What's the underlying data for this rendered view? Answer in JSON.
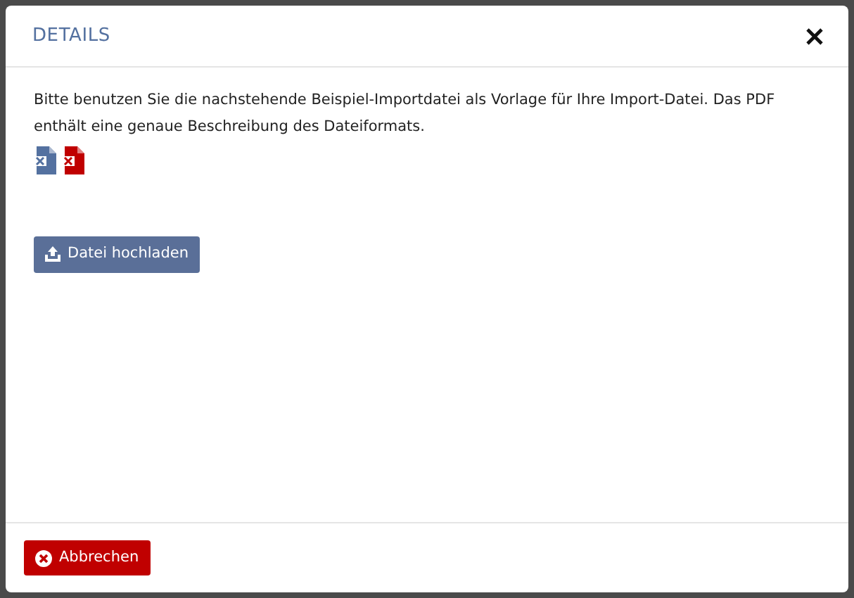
{
  "dialog": {
    "title": "DETAILS",
    "description": "Bitte benutzen Sie die nachstehende Beispiel-Importdatei als Vorlage für Ihre Import-Datei. Das PDF enthält eine genaue Beschreibung des Dateiformats.",
    "files": [
      {
        "kind": "csv"
      },
      {
        "kind": "pdf"
      }
    ],
    "upload_button": "Datei hochladen",
    "cancel_button": "Abbrechen"
  }
}
